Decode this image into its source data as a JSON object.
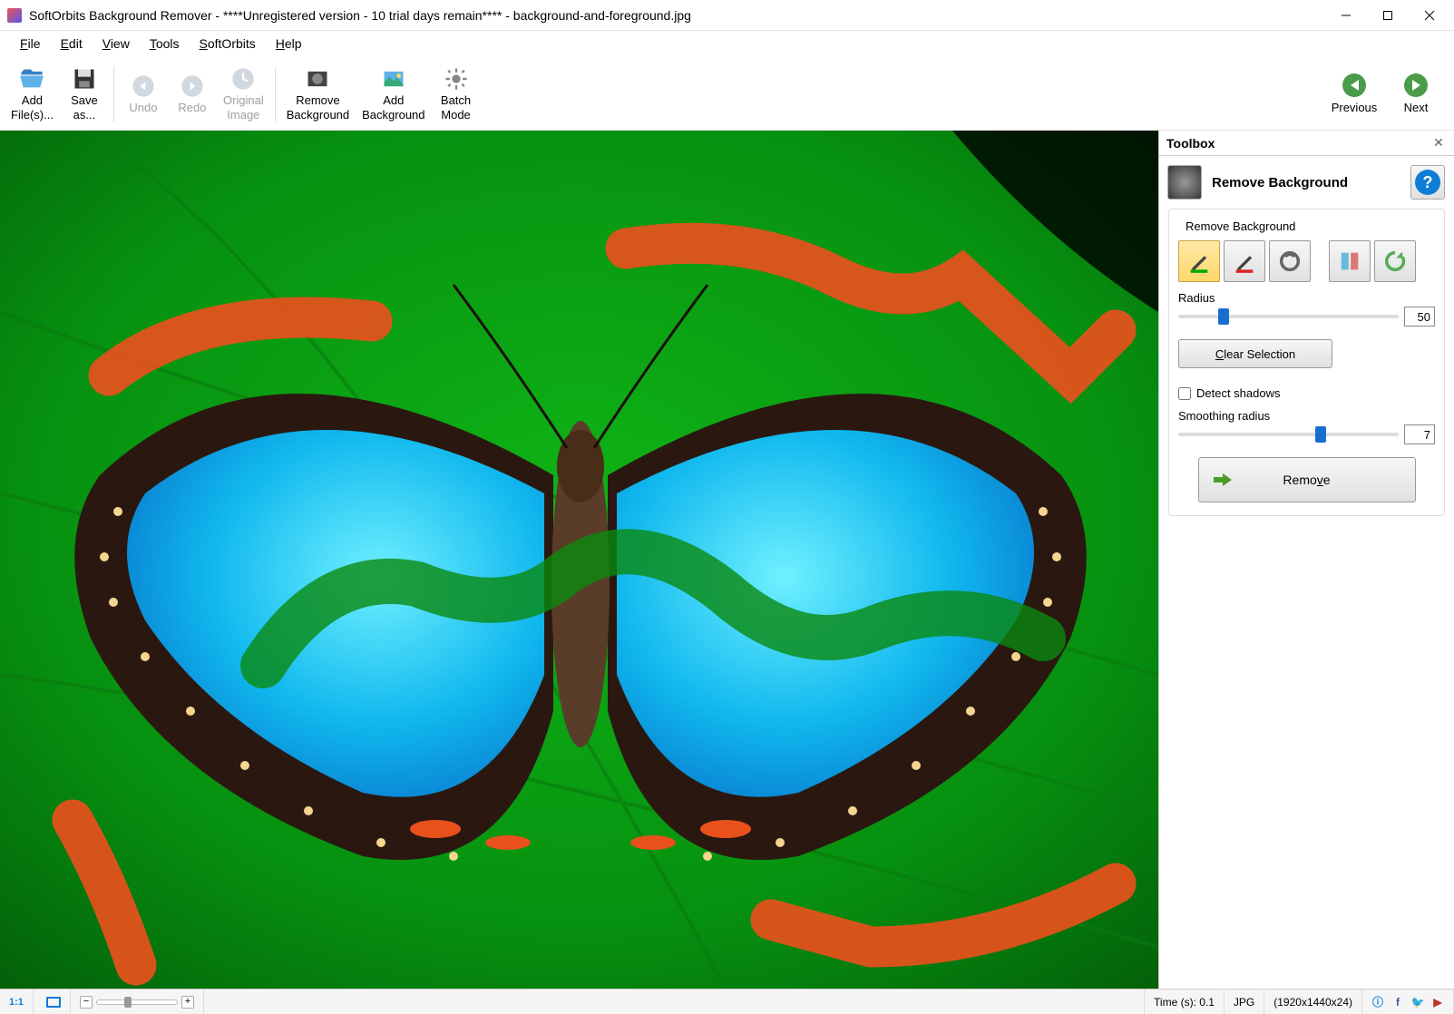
{
  "window": {
    "title": "SoftOrbits Background Remover - ****Unregistered version - 10 trial days remain**** - background-and-foreground.jpg"
  },
  "menu": {
    "items": [
      "File",
      "Edit",
      "View",
      "Tools",
      "SoftOrbits",
      "Help"
    ]
  },
  "toolbar": {
    "add_files": "Add\nFile(s)...",
    "save_as": "Save\nas...",
    "undo": "Undo",
    "redo": "Redo",
    "original_image": "Original\nImage",
    "remove_bg": "Remove\nBackground",
    "add_bg": "Add\nBackground",
    "batch_mode": "Batch\nMode",
    "previous": "Previous",
    "next": "Next"
  },
  "toolbox": {
    "title": "Toolbox",
    "tool_header": "Remove Background",
    "group_label": "Remove Background",
    "radius_label": "Radius",
    "radius_value": "50",
    "clear_selection": "Clear Selection",
    "detect_shadows": "Detect shadows",
    "smoothing_label": "Smoothing radius",
    "smoothing_value": "7",
    "remove_btn": "Remove"
  },
  "status": {
    "zoom_label": "1:1",
    "time_label": "Time (s): 0.1",
    "format": "JPG",
    "dimensions": "(1920x1440x24)"
  }
}
